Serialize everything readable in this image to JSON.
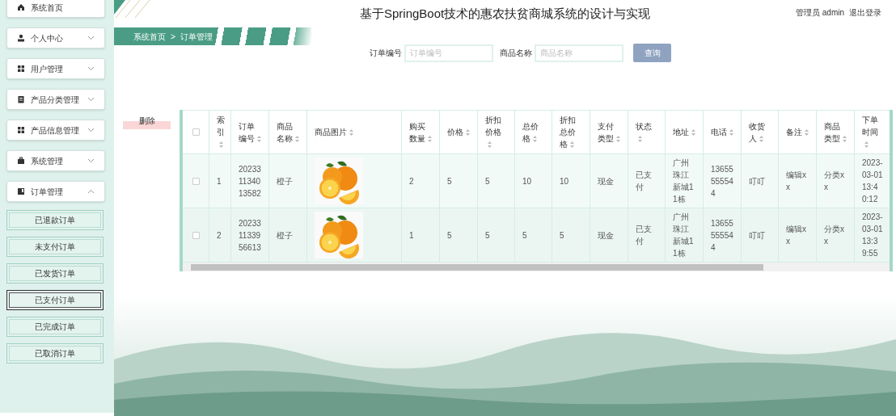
{
  "sidebar": {
    "items": [
      {
        "label": "系统首页",
        "kind": "link"
      },
      {
        "label": "个人中心",
        "kind": "menu",
        "expanded": false
      },
      {
        "label": "用户管理",
        "kind": "menu",
        "expanded": false
      },
      {
        "label": "产品分类管理",
        "kind": "menu",
        "expanded": false
      },
      {
        "label": "产品信息管理",
        "kind": "menu",
        "expanded": false
      },
      {
        "label": "系统管理",
        "kind": "menu",
        "expanded": false
      },
      {
        "label": "订单管理",
        "kind": "menu",
        "expanded": true,
        "children": [
          {
            "label": "已退款订单",
            "selected": false
          },
          {
            "label": "未支付订单",
            "selected": false
          },
          {
            "label": "已发货订单",
            "selected": false
          },
          {
            "label": "已支付订单",
            "selected": true
          },
          {
            "label": "已完成订单",
            "selected": false
          },
          {
            "label": "已取消订单",
            "selected": false
          }
        ]
      }
    ]
  },
  "header": {
    "title": "基于SpringBoot技术的惠农扶贫商城系统的设计与实现",
    "user": "管理员 admin",
    "logout": "退出登录"
  },
  "breadcrumb": [
    "系统首页",
    ">",
    "订单管理"
  ],
  "search": {
    "fields": [
      {
        "label": "订单编号",
        "placeholder": "订单编号"
      },
      {
        "label": "商品名称",
        "placeholder": "商品名称"
      }
    ],
    "button": "查询"
  },
  "delete_button": "删除",
  "table": {
    "header_checked": false,
    "columns": [
      "索引",
      "订单编号",
      "商品名称",
      "商品图片",
      "购买数量",
      "价格",
      "折扣价格",
      "总价格",
      "折扣总价格",
      "支付类型",
      "状态",
      "地址",
      "电话",
      "收货人",
      "备注",
      "商品类型",
      "下单时间"
    ],
    "rows": [
      {
        "checked": false,
        "cells": [
          "1",
          "202331134013582",
          "橙子",
          {
            "kind": "picture"
          },
          "2",
          "5",
          "5",
          "10",
          "10",
          "现金",
          "已支付",
          "广州珠江新城11栋",
          "13655555544",
          "叮叮",
          "编辑xx",
          "分类xx",
          "2023-03-01 13:40:12"
        ]
      },
      {
        "checked": false,
        "cells": [
          "2",
          "202331133956613",
          "橙子",
          {
            "kind": "picture"
          },
          "1",
          "5",
          "5",
          "5",
          "5",
          "现金",
          "已支付",
          "广州珠江新城11栋",
          "13655555544",
          "叮叮",
          "编辑xx",
          "分类xx",
          "2023-03-01 13:39:55"
        ]
      }
    ]
  }
}
